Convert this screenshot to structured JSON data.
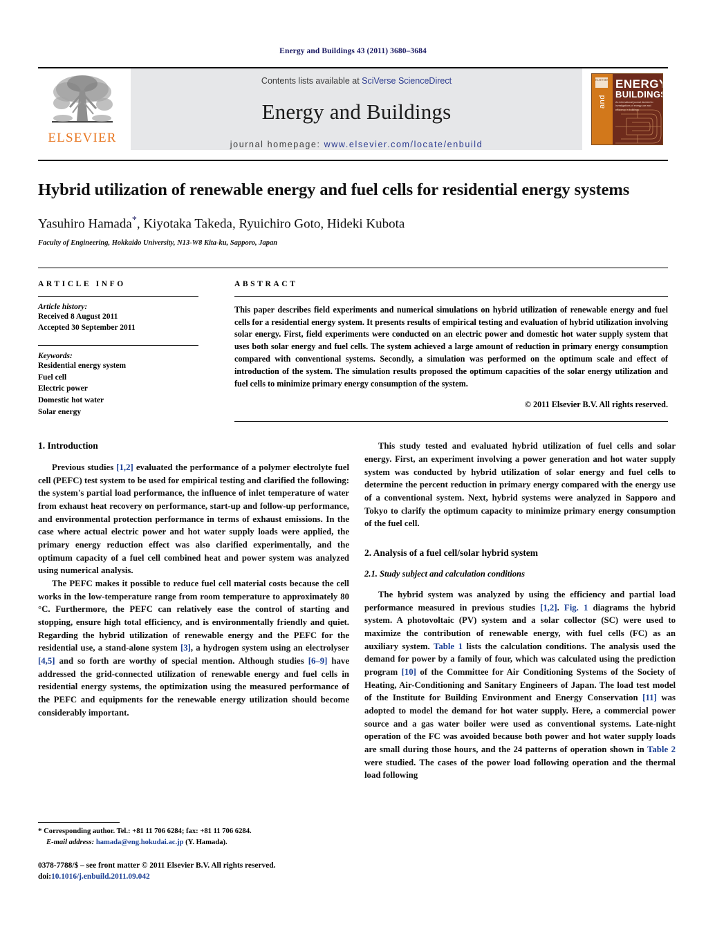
{
  "running_head": "Energy and Buildings 43 (2011) 3680–3684",
  "masthead": {
    "publisher_name": "ELSEVIER",
    "contents_prefix": "Contents lists available at ",
    "contents_link": "SciVerse ScienceDirect",
    "journal_name": "Energy and Buildings",
    "homepage_prefix": "journal homepage: ",
    "homepage_url": "www.elsevier.com/locate/enbuild",
    "cover": {
      "and_word": "and",
      "energy_word": "ENERGY",
      "buildings_word": "BUILDINGS",
      "subtitle": "An international journal devoted to investigations of energy use and efficiency in buildings",
      "els_mark": "ELSEVIER"
    }
  },
  "article": {
    "title": "Hybrid utilization of renewable energy and fuel cells for residential energy systems",
    "authors": "Yasuhiro Hamada",
    "authors_rest": ", Kiyotaka Takeda, Ryuichiro Goto, Hideki Kubota",
    "corresponding_marker": "*",
    "affiliation": "Faculty of Engineering, Hokkaido University, N13-W8 Kita-ku, Sapporo, Japan"
  },
  "article_info": {
    "heading": "ARTICLE INFO",
    "history_title": "Article history:",
    "received": "Received 8 August 2011",
    "accepted": "Accepted 30 September 2011",
    "keywords_title": "Keywords:",
    "keywords": [
      "Residential energy system",
      "Fuel cell",
      "Electric power",
      "Domestic hot water",
      "Solar energy"
    ]
  },
  "abstract": {
    "heading": "ABSTRACT",
    "text": "This paper describes field experiments and numerical simulations on hybrid utilization of renewable energy and fuel cells for a residential energy system. It presents results of empirical testing and evaluation of hybrid utilization involving solar energy. First, field experiments were conducted on an electric power and domestic hot water supply system that uses both solar energy and fuel cells. The system achieved a large amount of reduction in primary energy consumption compared with conventional systems. Secondly, a simulation was performed on the optimum scale and effect of introduction of the system. The simulation results proposed the optimum capacities of the solar energy utilization and fuel cells to minimize primary energy consumption of the system.",
    "copyright": "© 2011 Elsevier B.V. All rights reserved."
  },
  "body": {
    "section1_heading": "1. Introduction",
    "para1_a": "Previous studies ",
    "para1_ref": "[1,2]",
    "para1_b": " evaluated the performance of a polymer electrolyte fuel cell (PEFC) test system to be used for empirical testing and clarified the following: the system's partial load performance, the influence of inlet temperature of water from exhaust heat recovery on performance, start-up and follow-up performance, and environmental protection performance in terms of exhaust emissions. In the case where actual electric power and hot water supply loads were applied, the primary energy reduction effect was also clarified experimentally, and the optimum capacity of a fuel cell combined heat and power system was analyzed using numerical analysis.",
    "para2_a": "The PEFC makes it possible to reduce fuel cell material costs because the cell works in the low-temperature range from room temperature to approximately 80 °C. Furthermore, the PEFC can relatively ease the control of starting and stopping, ensure high total efficiency, and is environmentally friendly and quiet. Regarding the hybrid utilization of renewable energy and the PEFC for the residential use, a stand-alone system ",
    "para2_ref1": "[3]",
    "para2_b": ", a hydrogen system using an electrolyser ",
    "para2_ref2": "[4,5]",
    "para2_c": " and so forth are worthy of special mention. Although studies ",
    "para2_ref3": "[6–9]",
    "para2_d": " have addressed the grid-connected utilization of renewable energy and fuel cells in residential energy systems, the optimization using the measured performance of the PEFC and equipments for the renewable energy utilization should become considerably important.",
    "para3": "This study tested and evaluated hybrid utilization of fuel cells and solar energy. First, an experiment involving a power generation and hot water supply system was conducted by hybrid utilization of solar energy and fuel cells to determine the percent reduction in primary energy compared with the energy use of a conventional system. Next, hybrid systems were analyzed in Sapporo and Tokyo to clarify the optimum capacity to minimize primary energy consumption of the fuel cell.",
    "section2_heading": "2. Analysis of a fuel cell/solar hybrid system",
    "subsection21_heading": "2.1. Study subject and calculation conditions",
    "para4_a": "The hybrid system was analyzed by using the efficiency and partial load performance measured in previous studies ",
    "para4_ref1": "[1,2]",
    "para4_b": ". ",
    "para4_ref2": "Fig. 1",
    "para4_c": " diagrams the hybrid system. A photovoltaic (PV) system and a solar collector (SC) were used to maximize the contribution of renewable energy, with fuel cells (FC) as an auxiliary system. ",
    "para4_ref3": "Table 1",
    "para4_d": " lists the calculation conditions. The analysis used the demand for power by a family of four, which was calculated using the prediction program ",
    "para4_ref4": "[10]",
    "para4_e": " of the Committee for Air Conditioning Systems of the Society of Heating, Air-Conditioning and Sanitary Engineers of Japan. The load test model of the Institute for Building Environment and Energy Conservation ",
    "para4_ref5": "[11]",
    "para4_f": " was adopted to model the demand for hot water supply. Here, a commercial power source and a gas water boiler were used as conventional systems. Late-night operation of the FC was avoided because both power and hot water supply loads are small during those hours, and the 24 patterns of operation shown in ",
    "para4_ref6": "Table 2",
    "para4_g": " were studied. The cases of the power load following operation and the thermal load following"
  },
  "footnote": {
    "star": "*",
    "corresponding": " Corresponding author. Tel.: +81 11 706 6284; fax: +81 11 706 6284.",
    "email_label": "E-mail address:",
    "email": "hamada@eng.hokudai.ac.jp",
    "email_suffix": " (Y. Hamada).",
    "imprint": "0378-7788/$ – see front matter © 2011 Elsevier B.V. All rights reserved.",
    "doi_label": "doi:",
    "doi_value": "10.1016/j.enbuild.2011.09.042"
  },
  "colors": {
    "link_blue": "#1b3f94",
    "header_navy": "#1b1b63",
    "elsevier_orange": "#E87722",
    "band_grey": "#e6e7e9",
    "cover_maroon": "#6e2b1c"
  }
}
